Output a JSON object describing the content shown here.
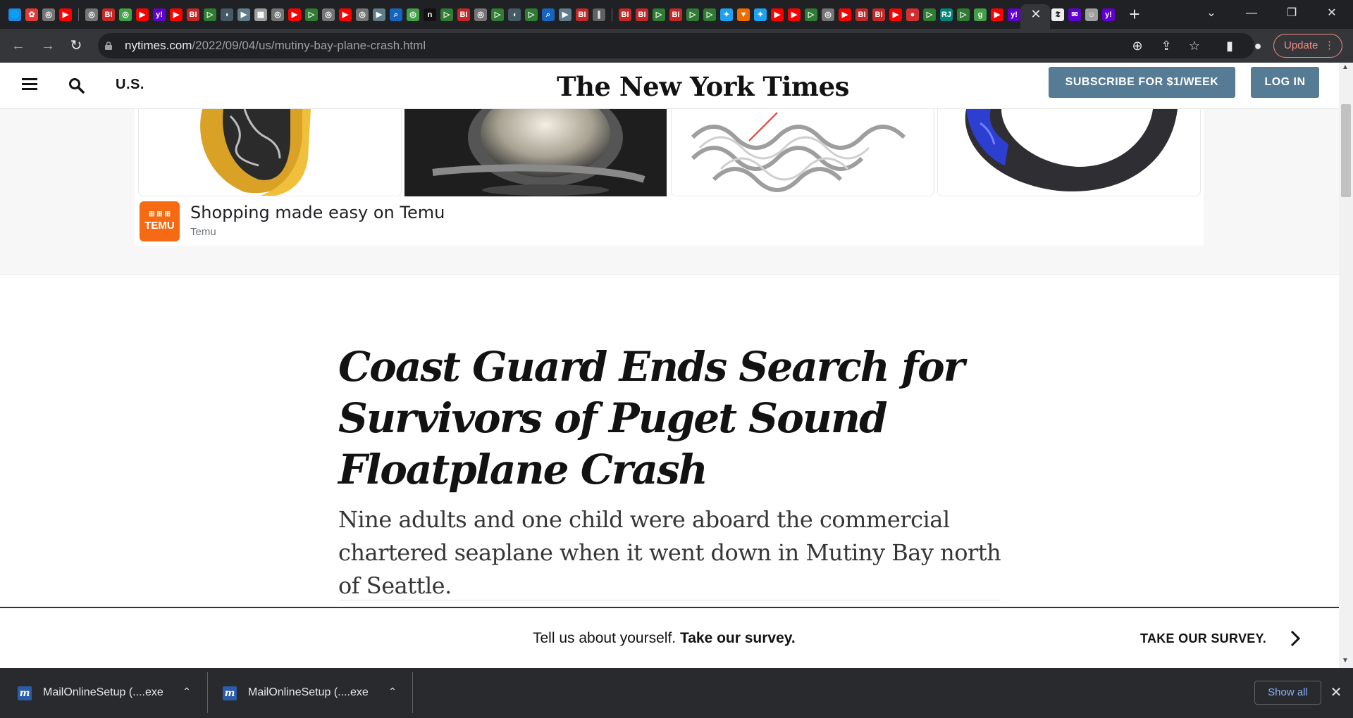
{
  "browser": {
    "url_host": "nytimes.com",
    "url_path": "/2022/09/04/us/mutiny-bay-plane-crash.html",
    "update_label": "Update",
    "tab_close_glyph": "✕",
    "new_tab_glyph": "+",
    "tab_favicons": [
      {
        "icon": "globe-icon",
        "color": "#1e88e5",
        "glyph": "🌐"
      },
      {
        "icon": "flower-icon",
        "color": "#e53935",
        "glyph": "✿"
      },
      {
        "icon": "globe-icon",
        "color": "#757575",
        "glyph": "◎"
      },
      {
        "icon": "youtube-icon",
        "color": "#ff0000",
        "glyph": "▶"
      },
      {
        "icon": "separator",
        "color": "",
        "glyph": ""
      },
      {
        "icon": "globe-icon",
        "color": "#757575",
        "glyph": "◎"
      },
      {
        "icon": "business-insider-icon",
        "color": "#c62828",
        "glyph": "BI"
      },
      {
        "icon": "globe-icon",
        "color": "#43a047",
        "glyph": "◎"
      },
      {
        "icon": "youtube-icon",
        "color": "#ff0000",
        "glyph": "▶"
      },
      {
        "icon": "yahoo-icon",
        "color": "#6001d2",
        "glyph": "y!"
      },
      {
        "icon": "youtube-icon",
        "color": "#ff0000",
        "glyph": "▶"
      },
      {
        "icon": "business-insider-icon",
        "color": "#c62828",
        "glyph": "BI"
      },
      {
        "icon": "play-icon",
        "color": "#2e7d32",
        "glyph": "▷"
      },
      {
        "icon": "shield-icon",
        "color": "#455a64",
        "glyph": "◖"
      },
      {
        "icon": "flag-icon",
        "color": "#607d8b",
        "glyph": "▶"
      },
      {
        "icon": "map-icon",
        "color": "#9e9e9e",
        "glyph": "▦"
      },
      {
        "icon": "globe-icon",
        "color": "#757575",
        "glyph": "◎"
      },
      {
        "icon": "youtube-icon",
        "color": "#ff0000",
        "glyph": "▶"
      },
      {
        "icon": "play-icon",
        "color": "#2e7d32",
        "glyph": "▷"
      },
      {
        "icon": "globe-icon",
        "color": "#757575",
        "glyph": "◎"
      },
      {
        "icon": "youtube-icon",
        "color": "#ff0000",
        "glyph": "▶"
      },
      {
        "icon": "globe-icon",
        "color": "#757575",
        "glyph": "◎"
      },
      {
        "icon": "flag-icon",
        "color": "#607d8b",
        "glyph": "▶"
      },
      {
        "icon": "search-icon",
        "color": "#1565c0",
        "glyph": "⌕"
      },
      {
        "icon": "globe-icon",
        "color": "#43a047",
        "glyph": "◎"
      },
      {
        "icon": "notion-icon",
        "color": "#111111",
        "glyph": "n"
      },
      {
        "icon": "play-icon",
        "color": "#2e7d32",
        "glyph": "▷"
      },
      {
        "icon": "business-insider-icon",
        "color": "#c62828",
        "glyph": "BI"
      },
      {
        "icon": "globe-icon",
        "color": "#757575",
        "glyph": "◎"
      },
      {
        "icon": "play-icon",
        "color": "#2e7d32",
        "glyph": "▷"
      },
      {
        "icon": "shield-icon",
        "color": "#455a64",
        "glyph": "◖"
      },
      {
        "icon": "play-icon",
        "color": "#2e7d32",
        "glyph": "▷"
      },
      {
        "icon": "search-icon",
        "color": "#1565c0",
        "glyph": "⌕"
      },
      {
        "icon": "flag-icon",
        "color": "#607d8b",
        "glyph": "▶"
      },
      {
        "icon": "business-insider-icon",
        "color": "#c62828",
        "glyph": "BI"
      },
      {
        "icon": "link-icon",
        "color": "#616161",
        "glyph": "∥"
      },
      {
        "icon": "separator",
        "color": "",
        "glyph": ""
      },
      {
        "icon": "business-insider-icon",
        "color": "#c62828",
        "glyph": "BI"
      },
      {
        "icon": "business-insider-icon",
        "color": "#c62828",
        "glyph": "BI"
      },
      {
        "icon": "play-icon",
        "color": "#2e7d32",
        "glyph": "▷"
      },
      {
        "icon": "business-insider-icon",
        "color": "#c62828",
        "glyph": "BI"
      },
      {
        "icon": "play-icon",
        "color": "#2e7d32",
        "glyph": "▷"
      },
      {
        "icon": "play-icon",
        "color": "#2e7d32",
        "glyph": "▷"
      },
      {
        "icon": "twitter-icon",
        "color": "#1da1f2",
        "glyph": "✦"
      },
      {
        "icon": "bookmark-icon",
        "color": "#ef6c00",
        "glyph": "▼"
      },
      {
        "icon": "twitter-icon",
        "color": "#1da1f2",
        "glyph": "✦"
      },
      {
        "icon": "youtube-icon",
        "color": "#ff0000",
        "glyph": "▶"
      },
      {
        "icon": "youtube-icon",
        "color": "#ff0000",
        "glyph": "▶"
      },
      {
        "icon": "play-icon",
        "color": "#2e7d32",
        "glyph": "▷"
      },
      {
        "icon": "globe-icon",
        "color": "#757575",
        "glyph": "◎"
      },
      {
        "icon": "youtube-icon",
        "color": "#ff0000",
        "glyph": "▶"
      },
      {
        "icon": "business-insider-icon",
        "color": "#c62828",
        "glyph": "BI"
      },
      {
        "icon": "business-insider-icon",
        "color": "#c62828",
        "glyph": "BI"
      },
      {
        "icon": "youtube-icon",
        "color": "#ff0000",
        "glyph": "▶"
      },
      {
        "icon": "pin-icon",
        "color": "#d32f2f",
        "glyph": "●"
      },
      {
        "icon": "play-icon",
        "color": "#2e7d32",
        "glyph": "▷"
      },
      {
        "icon": "rj-icon",
        "color": "#00897b",
        "glyph": "RJ"
      },
      {
        "icon": "play-icon",
        "color": "#2e7d32",
        "glyph": "▷"
      },
      {
        "icon": "g-icon",
        "color": "#43a047",
        "glyph": "g"
      },
      {
        "icon": "youtube-icon",
        "color": "#ff0000",
        "glyph": "▶"
      },
      {
        "icon": "yahoo-icon",
        "color": "#6001d2",
        "glyph": "y!"
      }
    ],
    "trailing_tabs": [
      {
        "icon": "nyt-icon",
        "color": "#eeeeee",
        "glyph": "𝕿"
      },
      {
        "icon": "yahoo-mail-icon",
        "color": "#6001d2",
        "glyph": "✉"
      },
      {
        "icon": "avatar-icon",
        "color": "#9e9e9e",
        "glyph": "☺"
      },
      {
        "icon": "yahoo-icon",
        "color": "#6001d2",
        "glyph": "y!"
      }
    ]
  },
  "nyt": {
    "section_label": "U.S.",
    "logo_text": "The New York Times",
    "subscribe_label": "SUBSCRIBE FOR $1/WEEK",
    "login_label": "LOG IN"
  },
  "ad": {
    "title": "Shopping made easy on Temu",
    "source": "Temu",
    "logo_text": "TEMU",
    "logo_color": "#f56a12"
  },
  "article": {
    "headline": "Coast Guard Ends Search for Survivors of Puget Sound Floatplane Crash",
    "summary": "Nine adults and one child were aboard the commercial chartered seaplane when it went down in Mutiny Bay north of Seattle."
  },
  "survey": {
    "lead": "Tell us about yourself.",
    "bold": "Take our survey.",
    "cta": "TAKE OUR SURVEY."
  },
  "downloads": {
    "items": [
      {
        "name": "MailOnlineSetup (....exe"
      },
      {
        "name": "MailOnlineSetup (....exe"
      }
    ],
    "show_all_label": "Show all"
  }
}
